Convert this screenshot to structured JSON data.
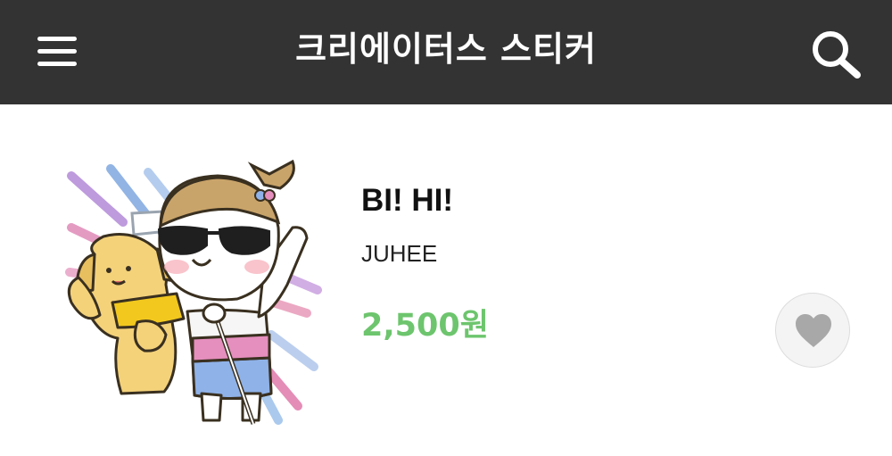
{
  "header": {
    "title": "크리에이터스 스티커",
    "menu_icon": "hamburger-menu-icon",
    "search_icon": "search-icon"
  },
  "item": {
    "title": "BI! HI!",
    "author": "JUHEE",
    "price": "2,500원",
    "like_icon": "heart-icon",
    "thumbnail": "sticker-character-with-dog"
  },
  "colors": {
    "header_bg": "#333333",
    "price": "#6dc56d",
    "like_heart": "#a8a8a8"
  }
}
